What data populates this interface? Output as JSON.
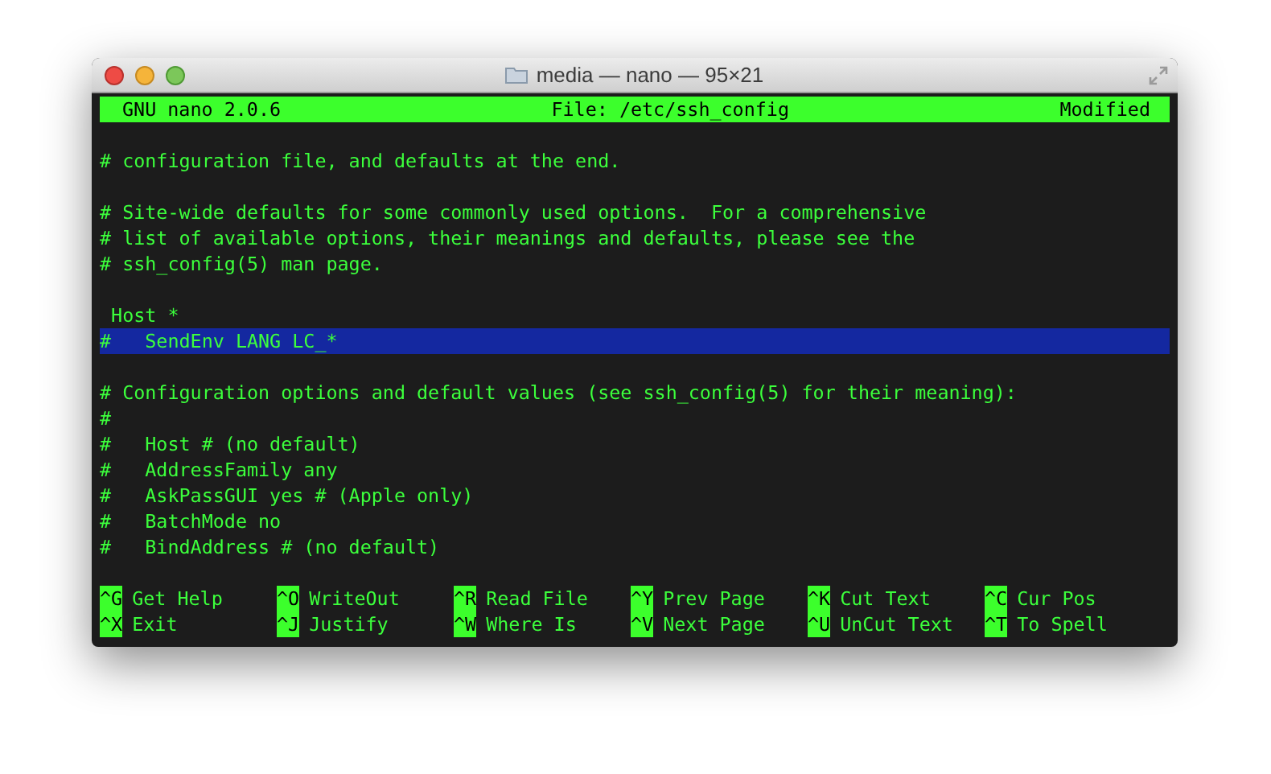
{
  "window": {
    "title": "media — nano — 95×21"
  },
  "header": {
    "app": "GNU nano 2.0.6",
    "file": "File: /etc/ssh_config",
    "status": "Modified"
  },
  "lines": [
    {
      "kind": "blank",
      "selected": false
    },
    {
      "kind": "text",
      "text": "# configuration file, and defaults at the end.",
      "selected": false
    },
    {
      "kind": "blank",
      "selected": false
    },
    {
      "kind": "text",
      "text": "# Site-wide defaults for some commonly used options.  For a comprehensive",
      "selected": false
    },
    {
      "kind": "text",
      "text": "# list of available options, their meanings and defaults, please see the",
      "selected": false
    },
    {
      "kind": "text",
      "text": "# ssh_config(5) man page.",
      "selected": false
    },
    {
      "kind": "blank",
      "selected": false
    },
    {
      "kind": "text",
      "text": " Host *",
      "selected": false
    },
    {
      "kind": "text",
      "text": "#   SendEnv LANG LC_*",
      "selected": true
    },
    {
      "kind": "blank",
      "selected": false
    },
    {
      "kind": "text",
      "text": "# Configuration options and default values (see ssh_config(5) for their meaning):",
      "selected": false
    },
    {
      "kind": "text",
      "text": "#",
      "selected": false
    },
    {
      "kind": "text",
      "text": "#   Host # (no default)",
      "selected": false
    },
    {
      "kind": "text",
      "text": "#   AddressFamily any",
      "selected": false
    },
    {
      "kind": "text",
      "text": "#   AskPassGUI yes # (Apple only)",
      "selected": false
    },
    {
      "kind": "text",
      "text": "#   BatchMode no",
      "selected": false
    },
    {
      "kind": "text",
      "text": "#   BindAddress # (no default)",
      "selected": false
    },
    {
      "kind": "blank",
      "selected": false
    }
  ],
  "shortcuts": [
    {
      "key": "^G",
      "label": "Get Help"
    },
    {
      "key": "^O",
      "label": "WriteOut"
    },
    {
      "key": "^R",
      "label": "Read File"
    },
    {
      "key": "^Y",
      "label": "Prev Page"
    },
    {
      "key": "^K",
      "label": "Cut Text"
    },
    {
      "key": "^C",
      "label": "Cur Pos"
    },
    {
      "key": "^X",
      "label": "Exit"
    },
    {
      "key": "^J",
      "label": "Justify"
    },
    {
      "key": "^W",
      "label": "Where Is"
    },
    {
      "key": "^V",
      "label": "Next Page"
    },
    {
      "key": "^U",
      "label": "UnCut Text"
    },
    {
      "key": "^T",
      "label": "To Spell"
    }
  ]
}
